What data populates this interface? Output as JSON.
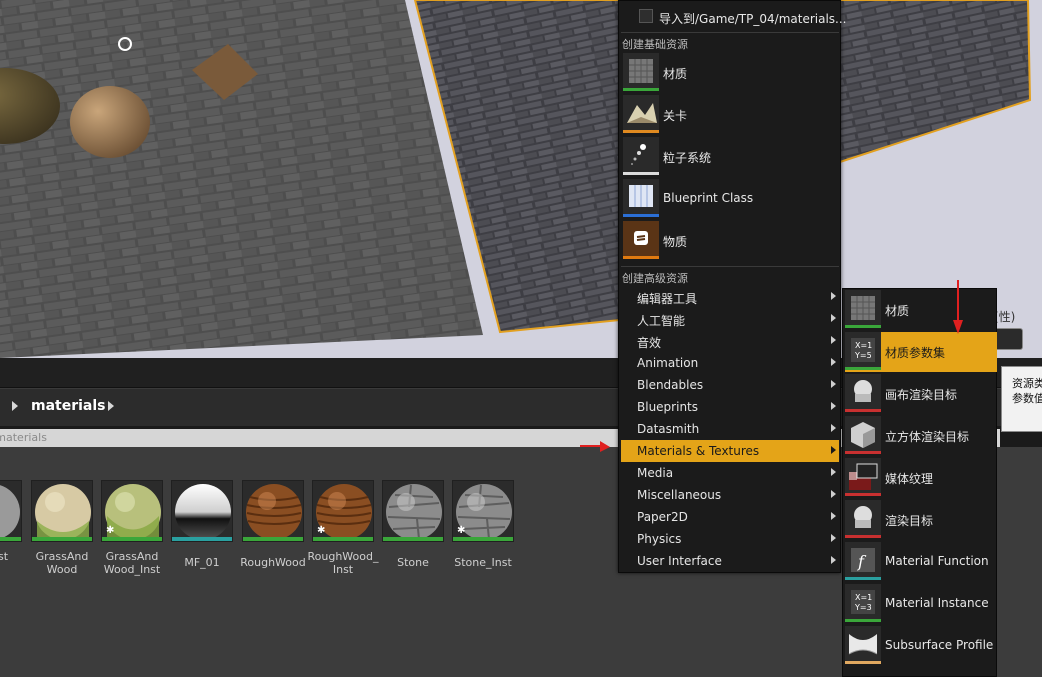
{
  "content_browser": {
    "path_folder": "materials",
    "search_placeholder": "Search materials",
    "assets": [
      {
        "label": "nst",
        "type": "stone-grey"
      },
      {
        "label": "GrassAnd\nWood",
        "type": "grass-wood"
      },
      {
        "label": "GrassAnd\nWood_Inst",
        "type": "grass-wood"
      },
      {
        "label": "MF_01",
        "type": "chrome"
      },
      {
        "label": "RoughWood",
        "type": "wood"
      },
      {
        "label": "RoughWood_\nInst",
        "type": "wood"
      },
      {
        "label": "Stone",
        "type": "stone"
      },
      {
        "label": "Stone_Inst",
        "type": "stone"
      }
    ]
  },
  "context_menu": {
    "import_label": "导入到/Game/TP_04/materials...",
    "section_basic": "创建基础资源",
    "basic_items": [
      {
        "label": "材质",
        "icon": "material-icon",
        "color": "#3aa63a"
      },
      {
        "label": "关卡",
        "icon": "level-icon",
        "color": "#e08a20"
      },
      {
        "label": "粒子系统",
        "icon": "particle-icon",
        "color": "#dcdcdc"
      },
      {
        "label": "Blueprint Class",
        "icon": "blueprint-icon",
        "color": "#2b6fd6"
      },
      {
        "label": "物质",
        "icon": "substance-icon",
        "color": "#e07a10"
      }
    ],
    "section_advanced": "创建高级资源",
    "advanced_items": [
      {
        "label": "编辑器工具",
        "active": false
      },
      {
        "label": "人工智能",
        "active": false
      },
      {
        "label": "音效",
        "active": false
      },
      {
        "label": "Animation",
        "active": false
      },
      {
        "label": "Blendables",
        "active": false
      },
      {
        "label": "Blueprints",
        "active": false
      },
      {
        "label": "Datasmith",
        "active": false
      },
      {
        "label": "Materials & Textures",
        "active": true
      },
      {
        "label": "Media",
        "active": false
      },
      {
        "label": "Miscellaneous",
        "active": false
      },
      {
        "label": "Paper2D",
        "active": false
      },
      {
        "label": "Physics",
        "active": false
      },
      {
        "label": "User Interface",
        "active": false
      }
    ]
  },
  "submenu": {
    "items": [
      {
        "label": "材质",
        "icon": "material-icon",
        "color": "#3aa63a",
        "active": false
      },
      {
        "label": "材质参数集",
        "icon": "parameter-collection-icon",
        "color": "#3aa63a",
        "active": true
      },
      {
        "label": "画布渲染目标",
        "icon": "canvas-render-target-icon",
        "color": "#c83030",
        "active": false
      },
      {
        "label": "立方体渲染目标",
        "icon": "cube-render-target-icon",
        "color": "#c83030",
        "active": false
      },
      {
        "label": "媒体纹理",
        "icon": "media-texture-icon",
        "color": "#c83030",
        "active": false
      },
      {
        "label": "渲染目标",
        "icon": "render-target-icon",
        "color": "#c83030",
        "active": false
      },
      {
        "label": "Material Function",
        "icon": "material-function-icon",
        "color": "#2aa0a0",
        "active": false
      },
      {
        "label": "Material Instance",
        "icon": "material-instance-icon",
        "color": "#3aa63a",
        "active": false
      },
      {
        "label": "Subsurface Profile",
        "icon": "subsurface-profile-icon",
        "color": "#e0a860",
        "active": false
      }
    ]
  },
  "tooltip": {
    "line1": "资源类",
    "line2": "参数值"
  },
  "right_fragment": {
    "text": "(性)"
  },
  "colors": {
    "accent": "#e4a418",
    "annotation_red": "#e02020"
  }
}
